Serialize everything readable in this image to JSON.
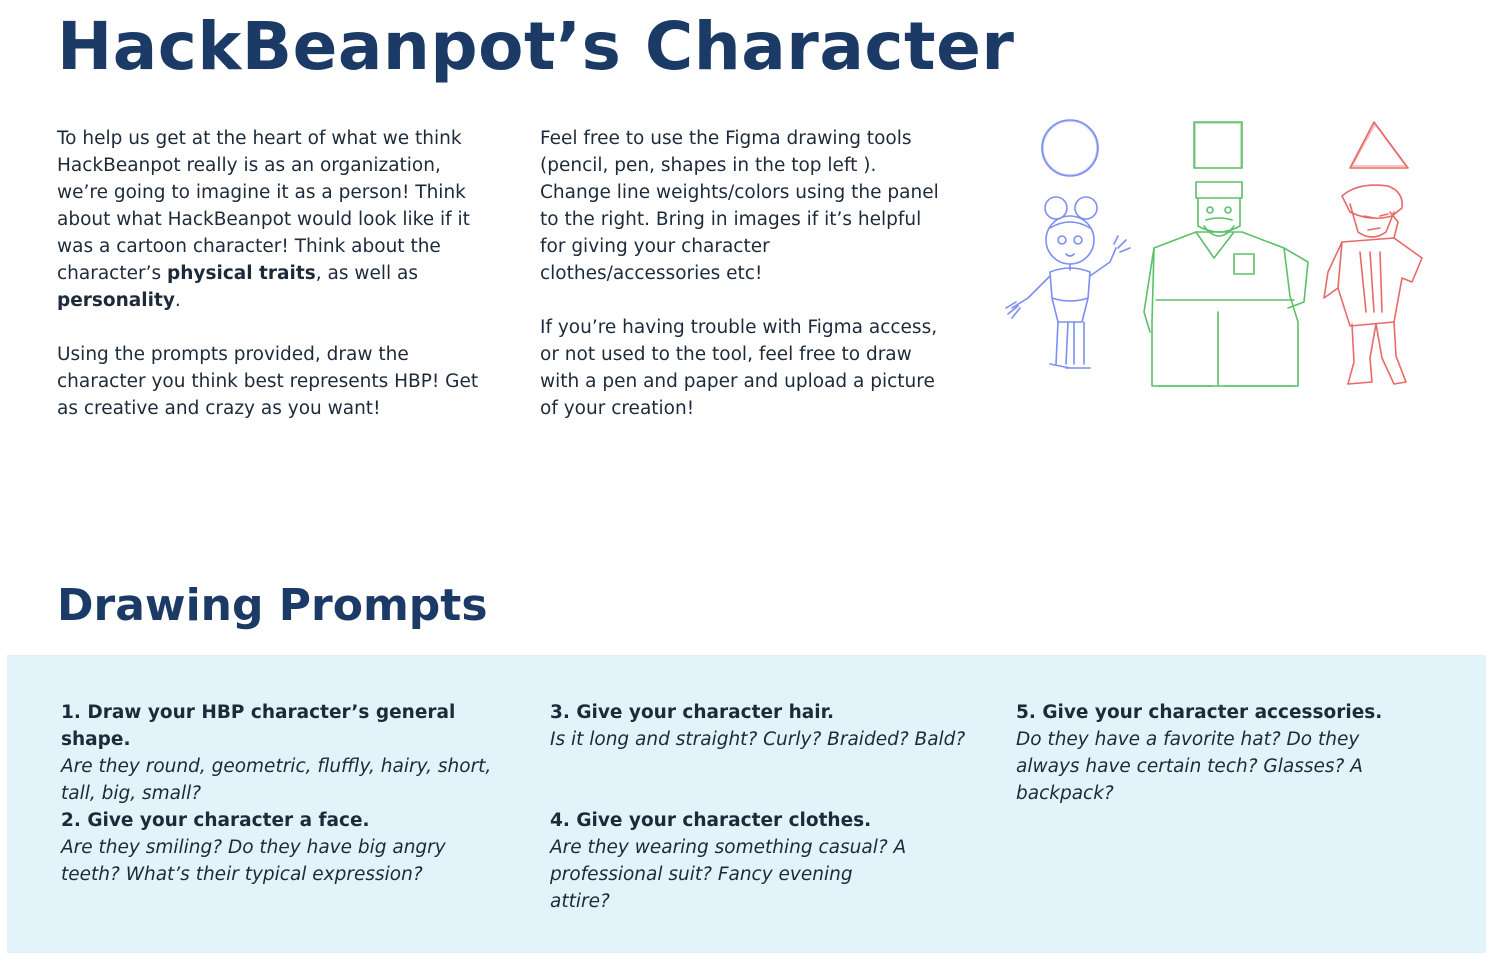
{
  "title": "HackBeanpot’s Character",
  "intro": {
    "p1_before": "To help us get at the heart of what we think HackBeanpot really is as an organization, we’re going to imagine it as a person! Think about what HackBeanpot would look like if it was a cartoon character! Think about the character’s ",
    "p1_bold1": "physical traits",
    "p1_mid": ", as well as ",
    "p1_bold2": "personality",
    "p1_end": ".",
    "p2": "Using the prompts provided, draw the character you think best represents HBP! Get as creative and crazy as you want!"
  },
  "tools": {
    "p1": "Feel free to use the Figma drawing tools (pencil, pen, shapes in the top left ). Change line weights/colors using the panel to the right. Bring in images if it’s helpful for giving your character clothes/accessories etc!",
    "p2": "If you’re having trouble with Figma access, or not used to the tool, feel free to draw with a pen and paper and upload a picture of your creation!"
  },
  "illustration": {
    "colors": {
      "circle": "#7d8ff0",
      "square": "#5cc06a",
      "triangle": "#e86a66"
    },
    "figures": [
      "circle-character",
      "square-character",
      "triangle-character"
    ]
  },
  "prompts_heading": "Drawing Prompts",
  "prompts": [
    {
      "title": "1. Draw your HBP character’s general shape.",
      "desc": "Are they round, geometric, fluffly, hairy, short, tall, big, small?"
    },
    {
      "title": "2. Give your character a face.",
      "desc": "Are they smiling? Do they have big angry teeth? What’s their typical expression?"
    },
    {
      "title": "3. Give your character hair.",
      "desc": "Is it long and straight? Curly? Braided? Bald?"
    },
    {
      "title": "4. Give your character clothes.",
      "desc": "Are they wearing something casual? A professional suit? Fancy evening attire?"
    },
    {
      "title": "5. Give your character accessories.",
      "desc": "Do they have a favorite hat? Do they always have certain tech? Glasses? A backpack?"
    }
  ],
  "theme": {
    "heading_color": "#1b3a66",
    "panel_bg": "#e2f3f9"
  }
}
